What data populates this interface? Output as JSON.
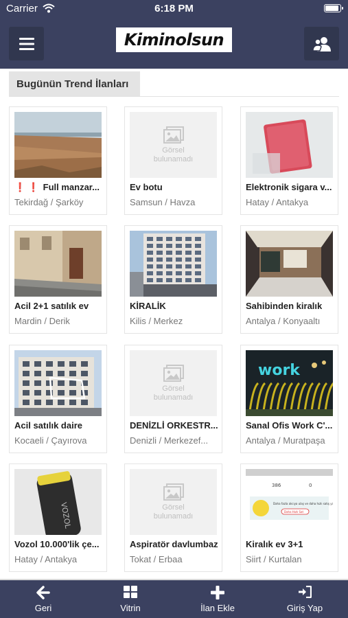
{
  "status_bar": {
    "carrier": "Carrier",
    "time": "6:18 PM",
    "battery_level": 1.0
  },
  "header": {
    "logo_text": "Kiminolsun",
    "menu_icon": "hamburger-menu-icon",
    "user_icon": "users-icon"
  },
  "section": {
    "title": "Bugünün Trend İlanları"
  },
  "placeholder": {
    "line1": "Görsel",
    "line2": "bulunamadı"
  },
  "listings": [
    {
      "title": "Full manzar...",
      "alert": "❗ ❗",
      "location": "Tekirdağ / Şarköy",
      "image": "land-photo"
    },
    {
      "title": "Ev botu",
      "location": "Samsun / Havza",
      "image": "placeholder"
    },
    {
      "title": "Elektronik sigara v...",
      "location": "Hatay / Antakya",
      "image": "device-photo"
    },
    {
      "title": "Acil 2+1 satılık ev",
      "location": "Mardin / Derik",
      "image": "street-photo"
    },
    {
      "title": "KİRALİK",
      "location": "Kilis / Merkez",
      "image": "building-photo"
    },
    {
      "title": "Sahibinden kiralık",
      "location": "Antalya / Konyaaltı",
      "image": "interior-photo"
    },
    {
      "title": "Acil satılık daire",
      "location": "Kocaeli / Çayırova",
      "image": "apartment-photo"
    },
    {
      "title": "DENİZLİ ORKESTR...",
      "location": "Denizli / Merkezef...",
      "image": "placeholder"
    },
    {
      "title": "Sanal Ofis Work C'...",
      "location": "Antalya / Muratpaşa",
      "image": "office-photo"
    },
    {
      "title": "Vozol 10.000'lik çe...",
      "location": "Hatay / Antakya",
      "image": "vape-photo"
    },
    {
      "title": "Aspiratör davlumbaz",
      "location": "Tokat / Erbaa",
      "image": "placeholder"
    },
    {
      "title": "Kiralık ev 3+1",
      "location": "Siirt / Kurtalan",
      "image": "screenshot-photo"
    }
  ],
  "screenshot_thumb": {
    "views": "386",
    "likes": "0",
    "promo": "Daha fazla alıcıya ulaş ve daha hızlı satış yap",
    "button": "Daha Hızlı Sat"
  },
  "vape_brand": "VOZOL",
  "office_sign": "work",
  "tabs": [
    {
      "label": "Geri",
      "icon": "arrow-left-icon"
    },
    {
      "label": "Vitrin",
      "icon": "grid-icon"
    },
    {
      "label": "İlan Ekle",
      "icon": "plus-icon"
    },
    {
      "label": "Giriş Yap",
      "icon": "sign-in-icon"
    }
  ],
  "colors": {
    "navbar": "#3b4160",
    "accent_red": "#d01b1b"
  }
}
